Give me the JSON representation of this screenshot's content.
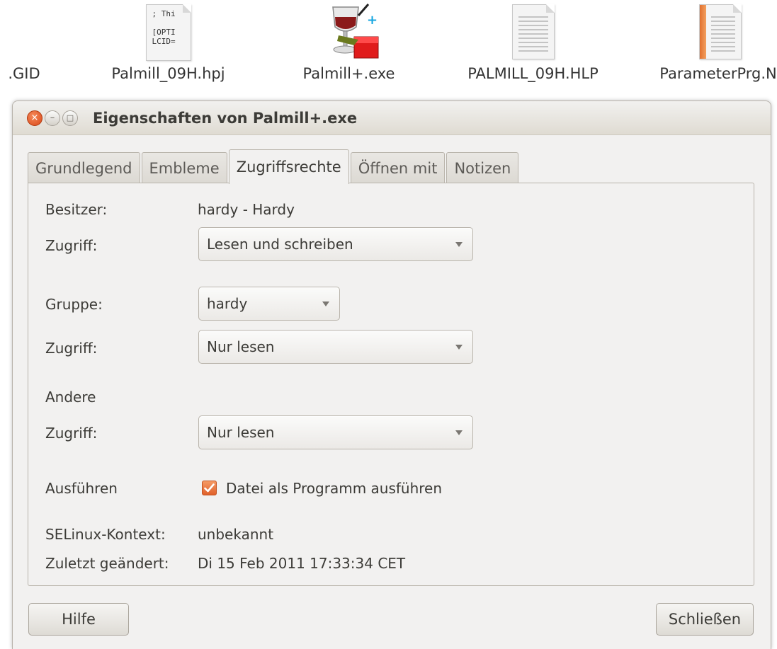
{
  "desktop": {
    "files": [
      {
        "name": ".GID",
        "icon": "document-icon"
      },
      {
        "name": "Palmill_09H.hpj",
        "icon": "text-file-icon",
        "preview": "; Thi\n\n[OPTI\nLCID="
      },
      {
        "name": "Palmill+.exe",
        "icon": "wine-exe-icon"
      },
      {
        "name": "PALMILL_09H.HLP",
        "icon": "document-icon"
      },
      {
        "name": "ParameterPrg.N",
        "icon": "orange-book-icon"
      }
    ]
  },
  "window": {
    "title": "Eigenschaften von Palmill+.exe",
    "controls": {
      "close": "×",
      "minimize": "–",
      "maximize": "□"
    }
  },
  "tabs": [
    {
      "label": "Grundlegend",
      "active": false
    },
    {
      "label": "Embleme",
      "active": false
    },
    {
      "label": "Zugriffsrechte",
      "active": true
    },
    {
      "label": "Öffnen mit",
      "active": false
    },
    {
      "label": "Notizen",
      "active": false
    }
  ],
  "permissions": {
    "owner_label": "Besitzer:",
    "owner_value": "hardy - Hardy",
    "owner_access_label": "Zugriff:",
    "owner_access_value": "Lesen und schreiben",
    "group_label": "Gruppe:",
    "group_value": "hardy",
    "group_access_label": "Zugriff:",
    "group_access_value": "Nur lesen",
    "others_label": "Andere",
    "others_access_label": "Zugriff:",
    "others_access_value": "Nur lesen",
    "execute_label": "Ausführen",
    "execute_checkbox_label": "Datei als Programm ausführen",
    "execute_checked": true,
    "selinux_label": "SELinux-Kontext:",
    "selinux_value": "unbekannt",
    "modified_label": "Zuletzt geändert:",
    "modified_value": "Di 15 Feb 2011 17:33:34 CET"
  },
  "buttons": {
    "help": "Hilfe",
    "close": "Schließen"
  },
  "colors": {
    "accent": "#e0602a",
    "window_bg": "#f2f1f0"
  }
}
